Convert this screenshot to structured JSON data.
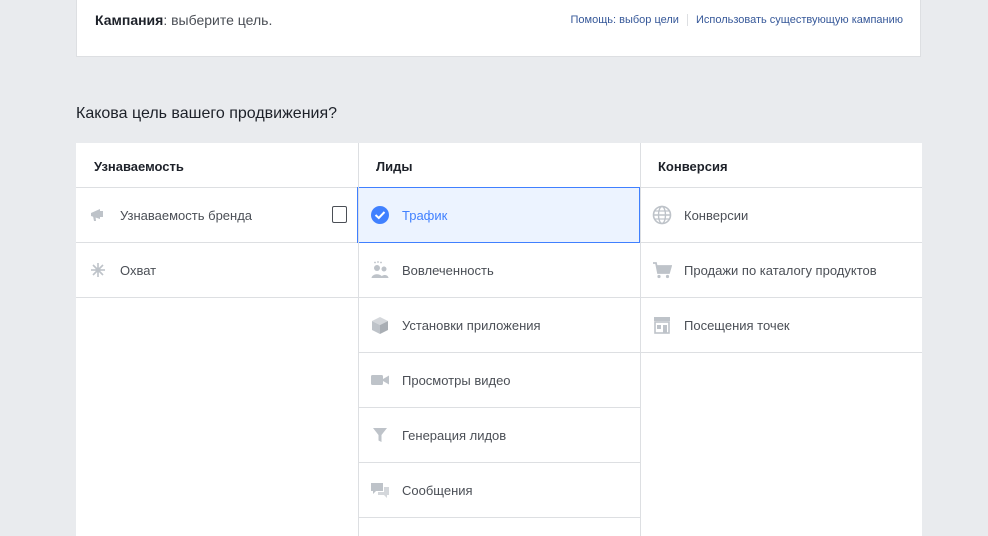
{
  "header": {
    "title_bold": "Кампания",
    "title_rest": ": выберите цель.",
    "link_help": "Помощь: выбор цели",
    "link_existing": "Использовать существующую кампанию"
  },
  "question": "Какова цель вашего продвижения?",
  "columns": [
    {
      "heading": "Узнаваемость",
      "items": [
        {
          "label": "Узнаваемость бренда",
          "icon": "megaphone-icon"
        },
        {
          "label": "Охват",
          "icon": "snowflake-icon"
        }
      ]
    },
    {
      "heading": "Лиды",
      "items": [
        {
          "label": "Трафик",
          "icon": "check-circle-icon",
          "selected": true
        },
        {
          "label": "Вовлеченность",
          "icon": "people-icon"
        },
        {
          "label": "Установки приложения",
          "icon": "box-icon"
        },
        {
          "label": "Просмотры видео",
          "icon": "video-camera-icon"
        },
        {
          "label": "Генерация лидов",
          "icon": "funnel-icon"
        },
        {
          "label": "Сообщения",
          "icon": "chat-bubbles-icon"
        }
      ]
    },
    {
      "heading": "Конверсия",
      "items": [
        {
          "label": "Конверсии",
          "icon": "globe-icon"
        },
        {
          "label": "Продажи по каталогу продуктов",
          "icon": "cart-icon"
        },
        {
          "label": "Посещения точек",
          "icon": "store-icon"
        }
      ]
    }
  ],
  "colors": {
    "accent": "#4080ff",
    "icon_gray": "#bec3c9",
    "link": "#365899",
    "background": "#e9ebee"
  }
}
